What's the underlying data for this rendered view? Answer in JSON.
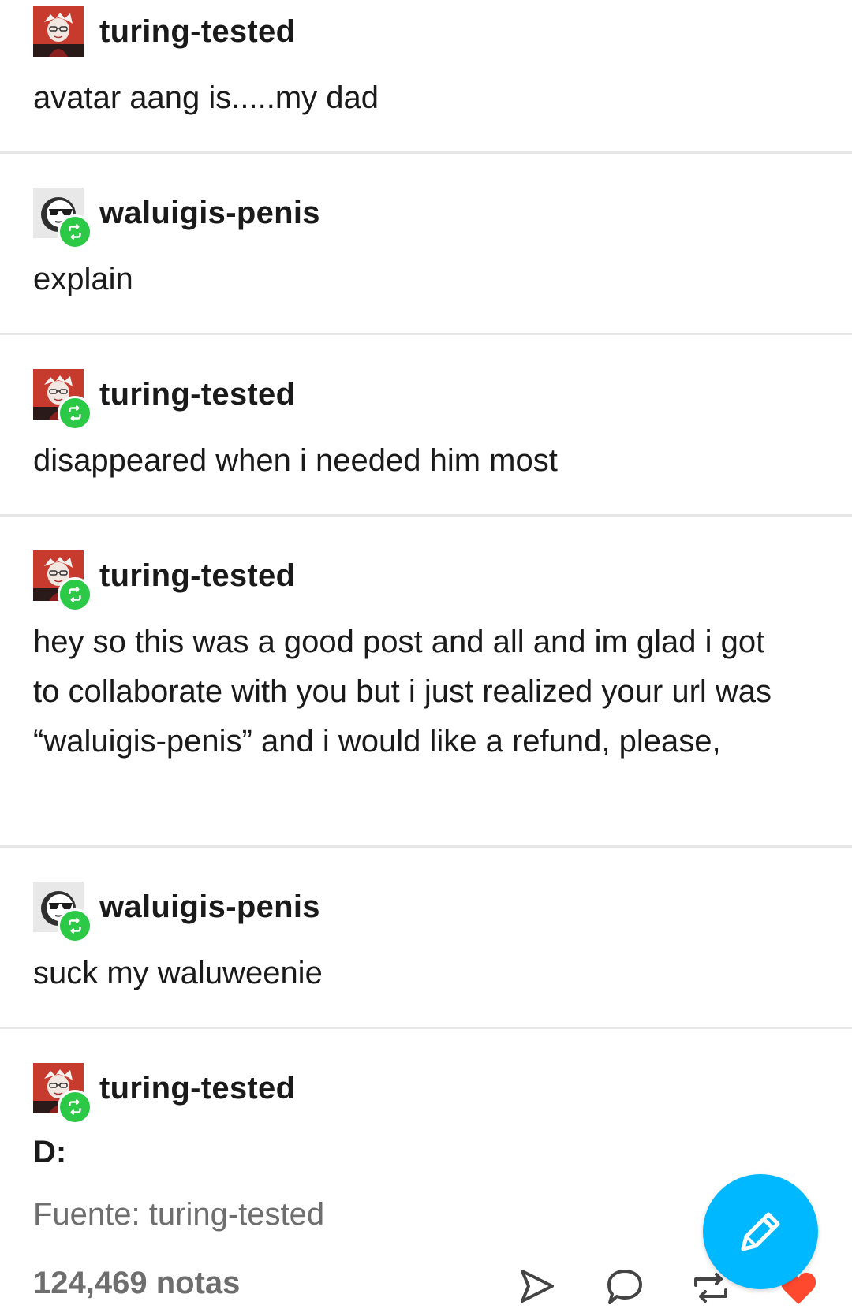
{
  "thread": [
    {
      "username": "turing-tested",
      "avatar": "red-character-avatar",
      "reblog": false,
      "text": "avatar aang is.....my dad"
    },
    {
      "username": "waluigis-penis",
      "avatar": "sunglasses-face-avatar",
      "reblog": true,
      "text": "explain"
    },
    {
      "username": "turing-tested",
      "avatar": "red-character-avatar",
      "reblog": true,
      "text": "disappeared when i needed him most"
    },
    {
      "username": "turing-tested",
      "avatar": "red-character-avatar",
      "reblog": true,
      "text": "hey so this was a good post and all and im glad i got to collaborate with you but i just realized your url was “waluigis-penis” and i would like a refund, please,"
    },
    {
      "username": "waluigis-penis",
      "avatar": "sunglasses-face-avatar",
      "reblog": true,
      "text": "suck my waluweenie"
    },
    {
      "username": "turing-tested",
      "avatar": "red-character-avatar",
      "reblog": true,
      "text": "D:"
    }
  ],
  "footer": {
    "source": "Fuente: turing-tested",
    "notes": "124,469 notas",
    "icons": [
      "send-icon",
      "comment-icon",
      "reblog-icon",
      "heart-icon"
    ]
  },
  "fab": {
    "icon": "pencil-icon"
  },
  "colors": {
    "reblog_badge": "#2bc946",
    "fab": "#00b8ff",
    "heart": "#ff492f",
    "muted_text": "#6e6e6e",
    "divider": "#e6e6e6"
  }
}
